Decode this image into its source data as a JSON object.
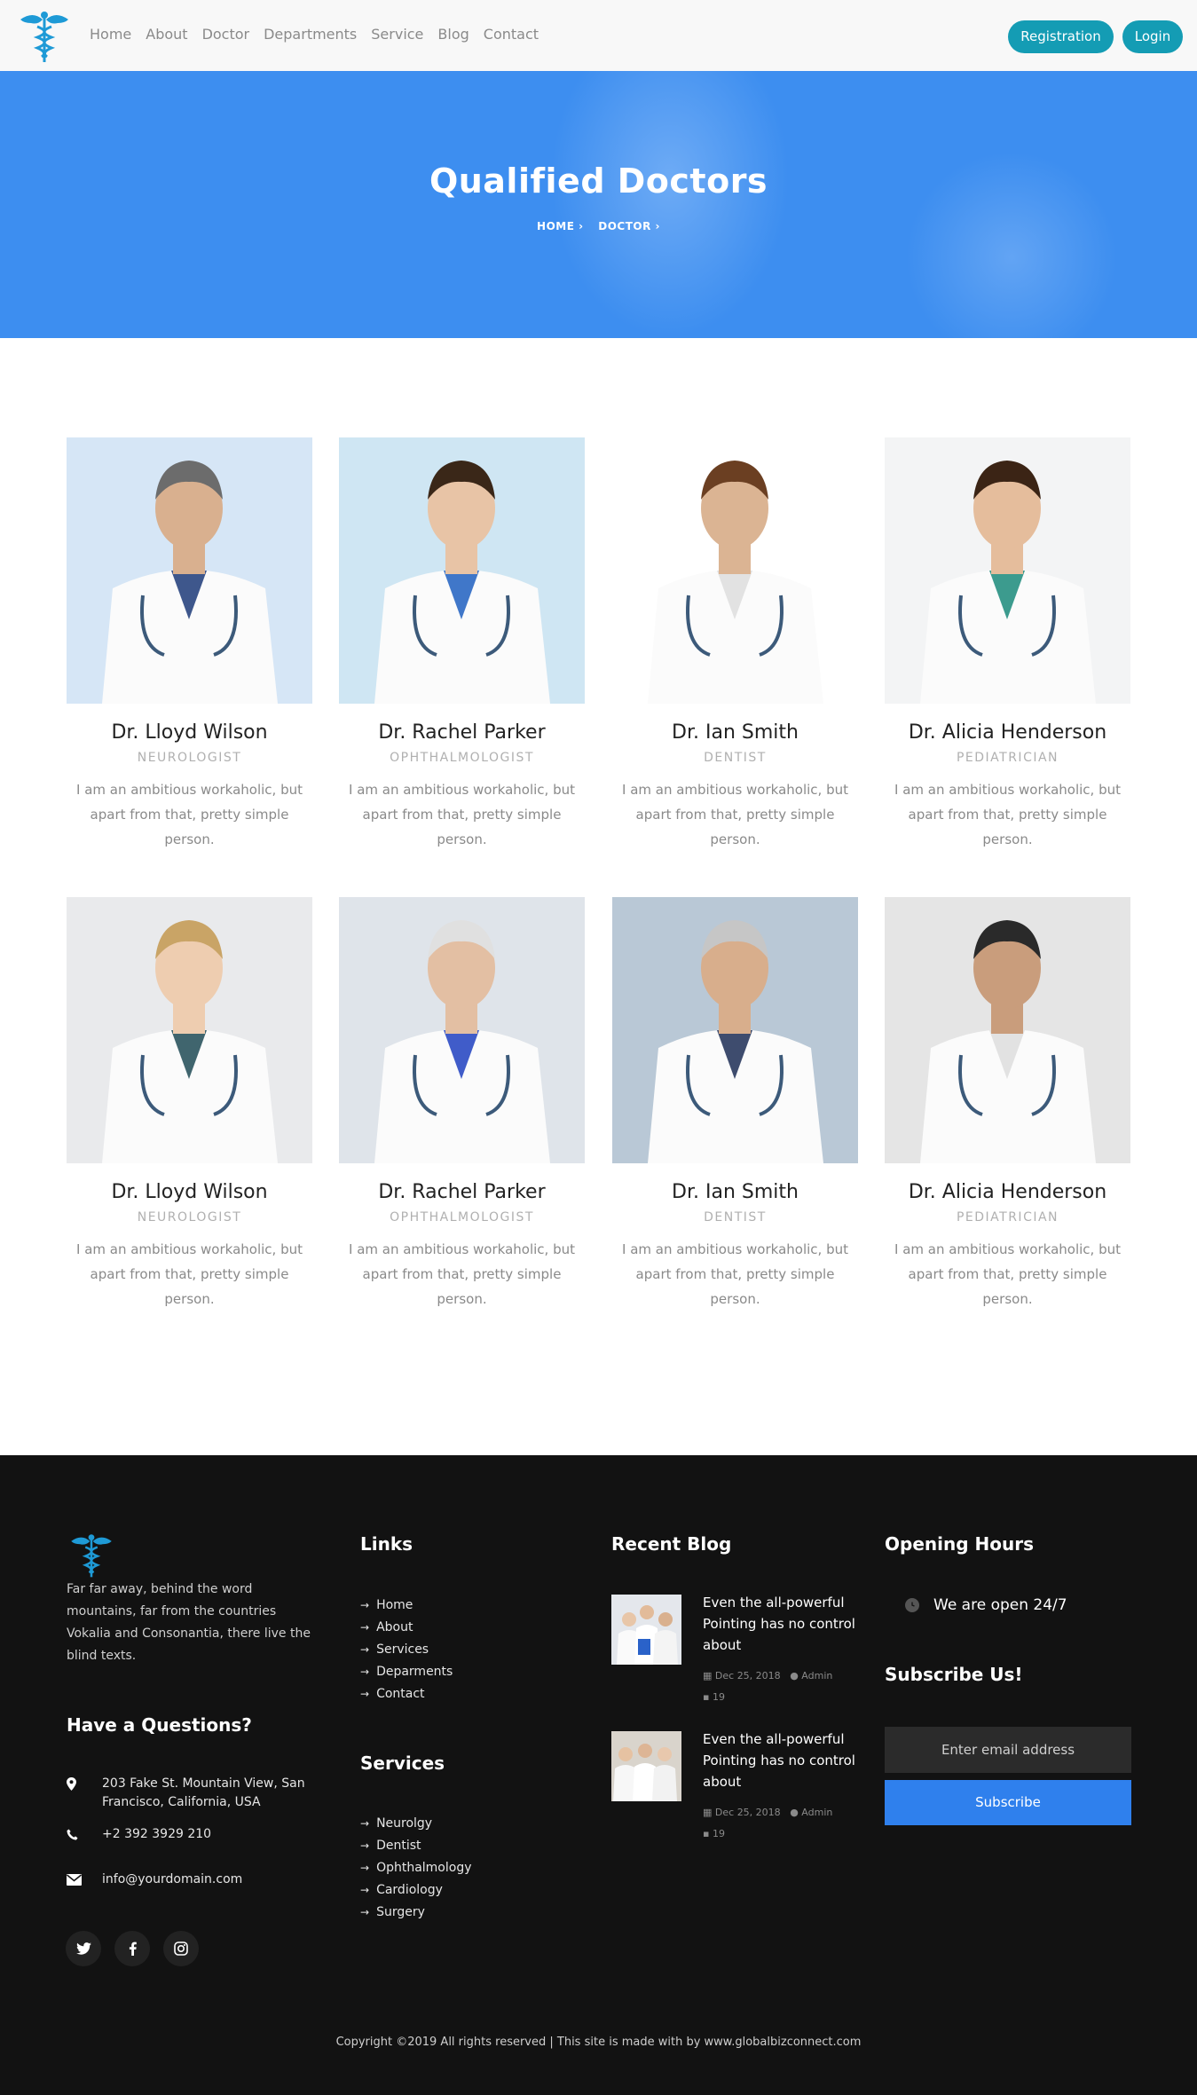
{
  "nav": {
    "links": [
      "Home",
      "About",
      "Doctor",
      "Departments",
      "Service",
      "Blog",
      "Contact"
    ],
    "registration": "Registration",
    "login": "Login"
  },
  "hero": {
    "title": "Qualified Doctors",
    "crumb_home": "HOME",
    "crumb_doctor": "DOCTOR"
  },
  "doctors": [
    {
      "name": "Dr. Lloyd Wilson",
      "role": "NEUROLOGIST",
      "desc": "I am an ambitious workaholic, but apart from that, pretty simple person."
    },
    {
      "name": "Dr. Rachel Parker",
      "role": "OPHTHALMOLOGIST",
      "desc": "I am an ambitious workaholic, but apart from that, pretty simple person."
    },
    {
      "name": "Dr. Ian Smith",
      "role": "DENTIST",
      "desc": "I am an ambitious workaholic, but apart from that, pretty simple person."
    },
    {
      "name": "Dr. Alicia Henderson",
      "role": "PEDIATRICIAN",
      "desc": "I am an ambitious workaholic, but apart from that, pretty simple person."
    },
    {
      "name": "Dr. Lloyd Wilson",
      "role": "NEUROLOGIST",
      "desc": "I am an ambitious workaholic, but apart from that, pretty simple person."
    },
    {
      "name": "Dr. Rachel Parker",
      "role": "OPHTHALMOLOGIST",
      "desc": "I am an ambitious workaholic, but apart from that, pretty simple person."
    },
    {
      "name": "Dr. Ian Smith",
      "role": "DENTIST",
      "desc": "I am an ambitious workaholic, but apart from that, pretty simple person."
    },
    {
      "name": "Dr. Alicia Henderson",
      "role": "PEDIATRICIAN",
      "desc": "I am an ambitious workaholic, but apart from that, pretty simple person."
    }
  ],
  "footer": {
    "about": "Far far away, behind the word mountains, far from the countries Vokalia and Consonantia, there live the blind texts.",
    "questions_title": "Have a Questions?",
    "address": "203 Fake St. Mountain View, San Francisco, California, USA",
    "phone": "+2 392 3929 210",
    "email": "info@yourdomain.com",
    "links_title": "Links",
    "links": [
      "Home",
      "About",
      "Services",
      "Deparments",
      "Contact"
    ],
    "services_title": "Services",
    "services": [
      "Neurolgy",
      "Dentist",
      "Ophthalmology",
      "Cardiology",
      "Surgery"
    ],
    "blog_title": "Recent Blog",
    "blog": [
      {
        "title": "Even the all-powerful Pointing has no control about",
        "date": "Dec 25, 2018",
        "author": "Admin",
        "comments": "19"
      },
      {
        "title": "Even the all-powerful Pointing has no control about",
        "date": "Dec 25, 2018",
        "author": "Admin",
        "comments": "19"
      }
    ],
    "hours_title": "Opening Hours",
    "hours_text": "We are open 24/7",
    "subscribe_title": "Subscribe Us!",
    "subscribe_placeholder": "Enter email address",
    "subscribe_button": "Subscribe",
    "copyright": "Copyright ©2019 All rights reserved | This site is made with by www.globalbizconnect.com"
  },
  "colors": {
    "accent_teal": "#149cb4",
    "hero_blue": "#3d8ef0",
    "subscribe_blue": "#2f80ed",
    "footer_bg": "#121212"
  }
}
